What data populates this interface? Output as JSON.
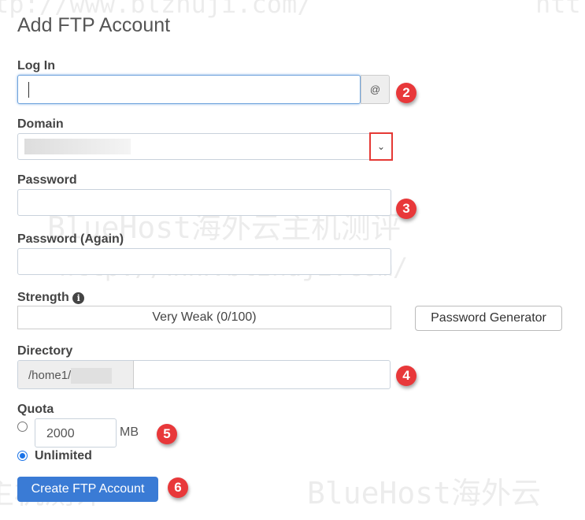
{
  "watermark": {
    "top": "tp://www.blzhuji.com/",
    "top_right": "htt",
    "mid": "BlueHost海外云主机测评",
    "url": "http://www.blzhuji.com/",
    "bottom_left": "主机测评",
    "bottom_right": "BlueHost海外云"
  },
  "page_title": "Add FTP Account",
  "login": {
    "label": "Log In",
    "value": "",
    "addon": "@"
  },
  "domain": {
    "label": "Domain",
    "value": ""
  },
  "password": {
    "label": "Password",
    "value": ""
  },
  "password_again": {
    "label": "Password (Again)",
    "value": ""
  },
  "strength": {
    "label": "Strength",
    "meter_text": "Very Weak (0/100)",
    "score": 0,
    "generator_label": "Password Generator"
  },
  "directory": {
    "label": "Directory",
    "prefix": "/home1/",
    "value": ""
  },
  "quota": {
    "label": "Quota",
    "value": "2000",
    "unit": "MB",
    "unlimited_label": "Unlimited",
    "selected": "Unlimited"
  },
  "submit_label": "Create FTP Account",
  "annotations": [
    "2",
    "3",
    "4",
    "5",
    "6"
  ],
  "colors": {
    "primary": "#3a7bd5",
    "badge": "#e8383a",
    "highlight": "#e53935"
  }
}
